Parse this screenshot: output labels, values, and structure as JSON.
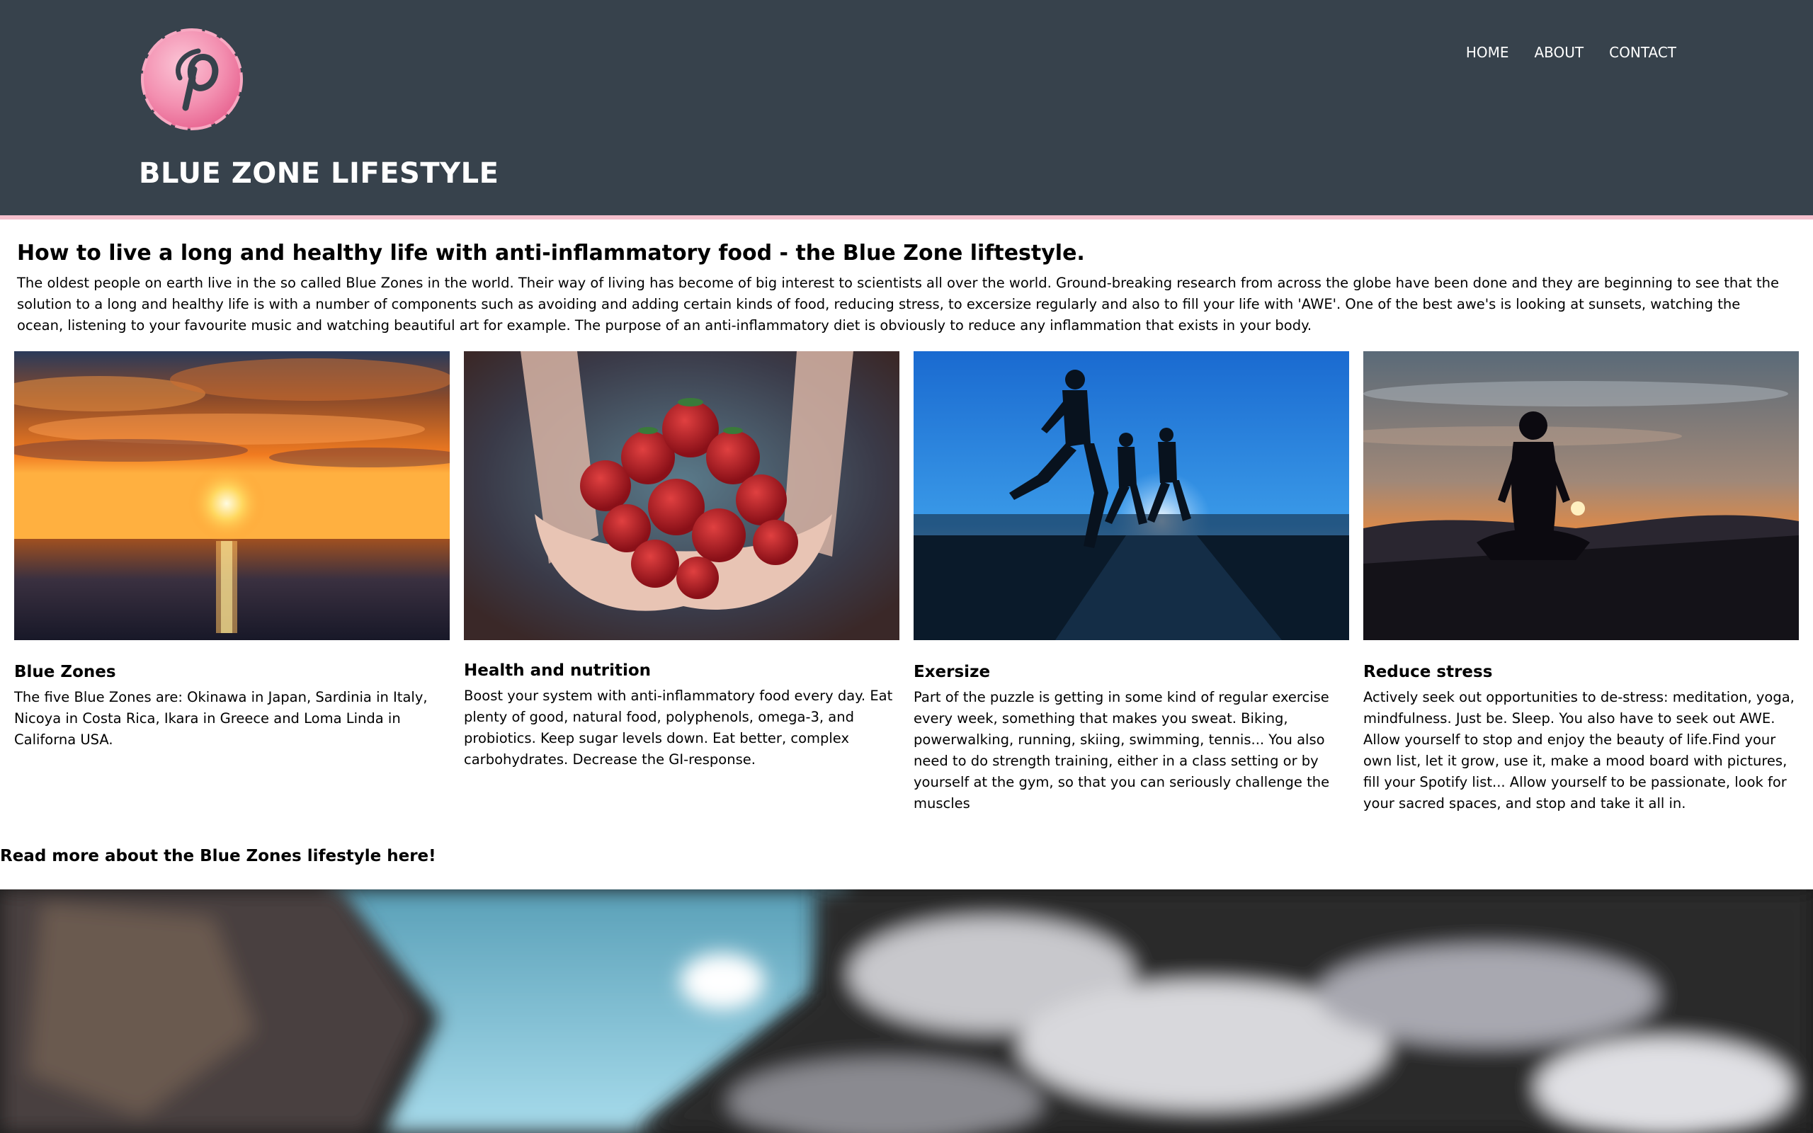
{
  "header": {
    "title": "BLUE ZONE LIFESTYLE",
    "nav": [
      "HOME",
      "ABOUT",
      "CONTACT"
    ],
    "logo_icon": "pinterest-icon",
    "background": "#37424c",
    "accent": "#f4bfcc"
  },
  "intro": {
    "heading": "How to live a long and healthy life with anti-inflammatory food - the Blue Zone liftestyle.",
    "body": "The oldest people on earth live in the so called Blue Zones in the world. Their way of living has become of big interest to scientists all over the world. Ground-breaking research from across the globe have been done and they are beginning to see that the solution to a long and healthy life is with a number of components such as avoiding and adding certain kinds of food, reducing stress, to excersize regularly and also to fill your life with 'AWE'. One of the best awe's is looking at sunsets, watching the ocean, listening to your favourite music and watching beautiful art for example. The purpose of an anti-inflammatory diet is obviously to reduce any inflammation that exists in your body."
  },
  "cards": [
    {
      "title": "Blue Zones",
      "text": "The five Blue Zones are: Okinawa in Japan, Sardinia in Italy, Nicoya in Costa Rica, Ikara in Greece and Loma Linda in Californa USA.",
      "image": "ocean-sunset-photo"
    },
    {
      "title": "Health and nutrition",
      "text": "Boost your system with anti-inflammatory food every day. Eat plenty of good, natural food, polyphenols, omega-3, and probiotics. Keep sugar levels down. Eat better, complex carbohydrates. Decrease the GI-response.",
      "image": "strawberries-in-hands-photo"
    },
    {
      "title": "Exersize",
      "text": "Part of the puzzle is getting in some kind of regular exercise every week, something that makes you sweat. Biking, powerwalking, running, skiing, swimming, tennis... You also need to do strength training, either in a class setting or by yourself at the gym, so that you can seriously challenge the muscles",
      "image": "runners-silhouette-photo"
    },
    {
      "title": "Reduce stress",
      "text": "Actively seek out opportunities to de-stress: meditation, yoga, mindfulness. Just be. Sleep. You also have to seek out AWE. Allow yourself to stop and enjoy the beauty of life.Find your own list, let it grow, use it, make a mood board with pictures, fill your Spotify list... Allow yourself to be passionate, look for your sacred spaces, and stop and take it all in.",
      "image": "meditation-sunset-photo"
    }
  ],
  "read_more": "Read more about the Blue Zones lifestyle here!",
  "hero_image": "waterfall-rocks-photo"
}
